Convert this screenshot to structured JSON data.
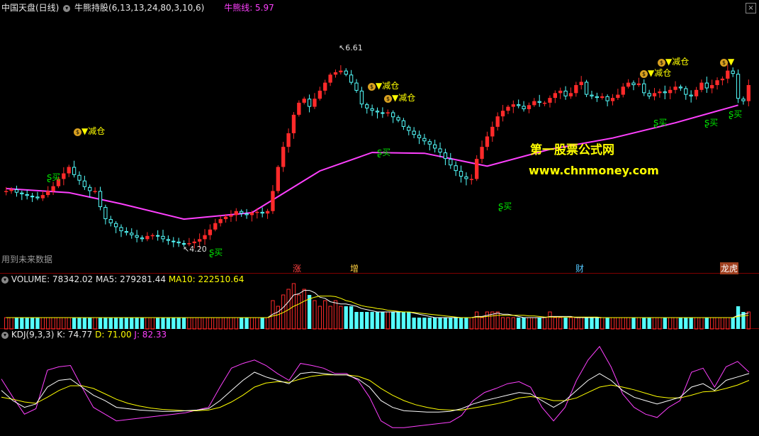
{
  "main_header": {
    "stock_name": "中国天盘(日线)",
    "indicator": "牛熊持股(6,13,13,24,80,3,10,6)",
    "line_label": "牛熊线: 5.97"
  },
  "vol_header": {
    "title": "VOLUME: 78342.02",
    "ma5": "MA5: 279281.44",
    "ma10": "MA10: 222510.64"
  },
  "kdj_header": {
    "title": "KDJ(9,3,3)",
    "k": "K: 74.77",
    "d": "D: 71.00",
    "j": "J: 82.33"
  },
  "future_notice": "用到未来数据",
  "watermark": {
    "line1": "第一股票公式网",
    "line2": "www.chnmoney.com"
  },
  "signals": {
    "buy": "买",
    "reduce": "▼减仓"
  },
  "markers": [
    "涨",
    "增",
    "财",
    "龙虎"
  ],
  "price_labels": {
    "high": "6.61",
    "low": "4.20"
  },
  "colors": {
    "up": "#ff2a2a",
    "down": "#54ffff",
    "ma": "#ff40ff",
    "bg": "#000000",
    "white": "#ffffff",
    "yellow": "#ffff00",
    "buy": "#00e000"
  },
  "chart_data": {
    "type": "candlestick",
    "series_name": "牛熊线",
    "closes": [
      4.9,
      4.92,
      4.88,
      4.86,
      4.84,
      4.83,
      4.81,
      4.85,
      4.9,
      4.96,
      5.05,
      5.12,
      5.2,
      5.1,
      5.03,
      4.95,
      4.9,
      4.9,
      4.7,
      4.55,
      4.5,
      4.45,
      4.4,
      4.38,
      4.35,
      4.32,
      4.3,
      4.34,
      4.35,
      4.34,
      4.3,
      4.28,
      4.27,
      4.25,
      4.24,
      4.25,
      4.27,
      4.3,
      4.35,
      4.42,
      4.5,
      4.55,
      4.58,
      4.6,
      4.65,
      4.62,
      4.6,
      4.63,
      4.64,
      4.62,
      4.65,
      4.9,
      5.2,
      5.45,
      5.62,
      5.85,
      6.0,
      6.05,
      5.95,
      6.05,
      6.15,
      6.25,
      6.35,
      6.38,
      6.4,
      6.35,
      6.25,
      6.15,
      5.98,
      5.93,
      5.9,
      5.88,
      5.87,
      5.88,
      5.82,
      5.78,
      5.7,
      5.65,
      5.6,
      5.56,
      5.52,
      5.48,
      5.43,
      5.38,
      5.3,
      5.22,
      5.15,
      5.08,
      5.05,
      5.05,
      5.3,
      5.45,
      5.58,
      5.7,
      5.83,
      5.9,
      5.95,
      5.98,
      5.96,
      5.92,
      5.97,
      6.02,
      6.0,
      6.0,
      6.06,
      6.12,
      6.15,
      6.08,
      6.12,
      6.22,
      6.26,
      6.1,
      6.08,
      6.06,
      6.08,
      6.02,
      6.06,
      6.1,
      6.2,
      6.25,
      6.22,
      6.24,
      6.12,
      6.08,
      6.12,
      6.14,
      6.12,
      6.16,
      6.2,
      6.18,
      6.1,
      6.08,
      6.16,
      6.25,
      6.18,
      6.22,
      6.28,
      6.3,
      6.4,
      6.36,
      6.05,
      6.02,
      6.22
    ],
    "ma_line": {
      "x": [
        0,
        12,
        22,
        34,
        47,
        60,
        70,
        80,
        92,
        104,
        116,
        128,
        140
      ],
      "y": [
        4.93,
        4.88,
        4.74,
        4.55,
        4.63,
        5.15,
        5.38,
        5.37,
        5.21,
        5.42,
        5.56,
        5.75,
        5.97
      ]
    },
    "volume": [
      2,
      2,
      2,
      2,
      2,
      2,
      2,
      2,
      2,
      2,
      2,
      2,
      2,
      2,
      2,
      2,
      2,
      2,
      2,
      2,
      2,
      2,
      2,
      2,
      2,
      2,
      2,
      2,
      2,
      2,
      2,
      2,
      2,
      2,
      2,
      2,
      2,
      2,
      2,
      2,
      2,
      2,
      2,
      2,
      2,
      2,
      2,
      2,
      2,
      2,
      2,
      5,
      4,
      6,
      7,
      8,
      6,
      7,
      6,
      5,
      4,
      5,
      4,
      5,
      4,
      4,
      4,
      3,
      3,
      3,
      3,
      3,
      3,
      3,
      3,
      3,
      3,
      3,
      2,
      2,
      2,
      2,
      2,
      2,
      2,
      2,
      2,
      2,
      2,
      2,
      3,
      2,
      3,
      3,
      3,
      2,
      2,
      2,
      2,
      2,
      2,
      2,
      2,
      2,
      3,
      2,
      2,
      2,
      2,
      2,
      2,
      2,
      2,
      2,
      2,
      2,
      2,
      2,
      2,
      2,
      2,
      2,
      2,
      2,
      2,
      2,
      2,
      2,
      2,
      2,
      2,
      2,
      2,
      2,
      2,
      2,
      2,
      2,
      2,
      2,
      4,
      3,
      3
    ],
    "kdj": {
      "k": [
        55,
        40,
        30,
        35,
        60,
        70,
        72,
        60,
        48,
        40,
        30,
        28,
        26,
        25,
        24,
        24,
        25,
        26,
        28,
        40,
        55,
        70,
        82,
        75,
        70,
        65,
        80,
        82,
        80,
        78,
        78,
        72,
        60,
        40,
        30,
        25,
        24,
        23,
        23,
        24,
        28,
        35,
        40,
        44,
        48,
        52,
        50,
        40,
        30,
        40,
        55,
        70,
        80,
        70,
        55,
        45,
        40,
        35,
        40,
        45,
        60,
        65,
        55,
        70,
        75,
        80
      ],
      "d": [
        45,
        42,
        38,
        36,
        45,
        55,
        62,
        62,
        58,
        50,
        42,
        36,
        32,
        29,
        27,
        26,
        25,
        25,
        26,
        30,
        38,
        48,
        60,
        66,
        68,
        67,
        72,
        76,
        78,
        78,
        78,
        76,
        70,
        58,
        48,
        40,
        34,
        30,
        27,
        26,
        26,
        29,
        32,
        35,
        39,
        44,
        46,
        44,
        40,
        40,
        44,
        52,
        60,
        63,
        60,
        56,
        51,
        46,
        44,
        44,
        48,
        53,
        54,
        58,
        63,
        70
      ],
      "j": [
        72,
        45,
        20,
        28,
        85,
        90,
        92,
        60,
        30,
        20,
        10,
        12,
        14,
        16,
        18,
        20,
        22,
        26,
        30,
        60,
        88,
        95,
        100,
        92,
        80,
        70,
        95,
        92,
        88,
        80,
        80,
        70,
        45,
        10,
        0,
        0,
        2,
        4,
        6,
        8,
        18,
        40,
        52,
        58,
        65,
        68,
        60,
        30,
        10,
        30,
        70,
        100,
        120,
        90,
        50,
        30,
        20,
        15,
        30,
        40,
        82,
        88,
        60,
        90,
        98,
        82
      ]
    }
  }
}
